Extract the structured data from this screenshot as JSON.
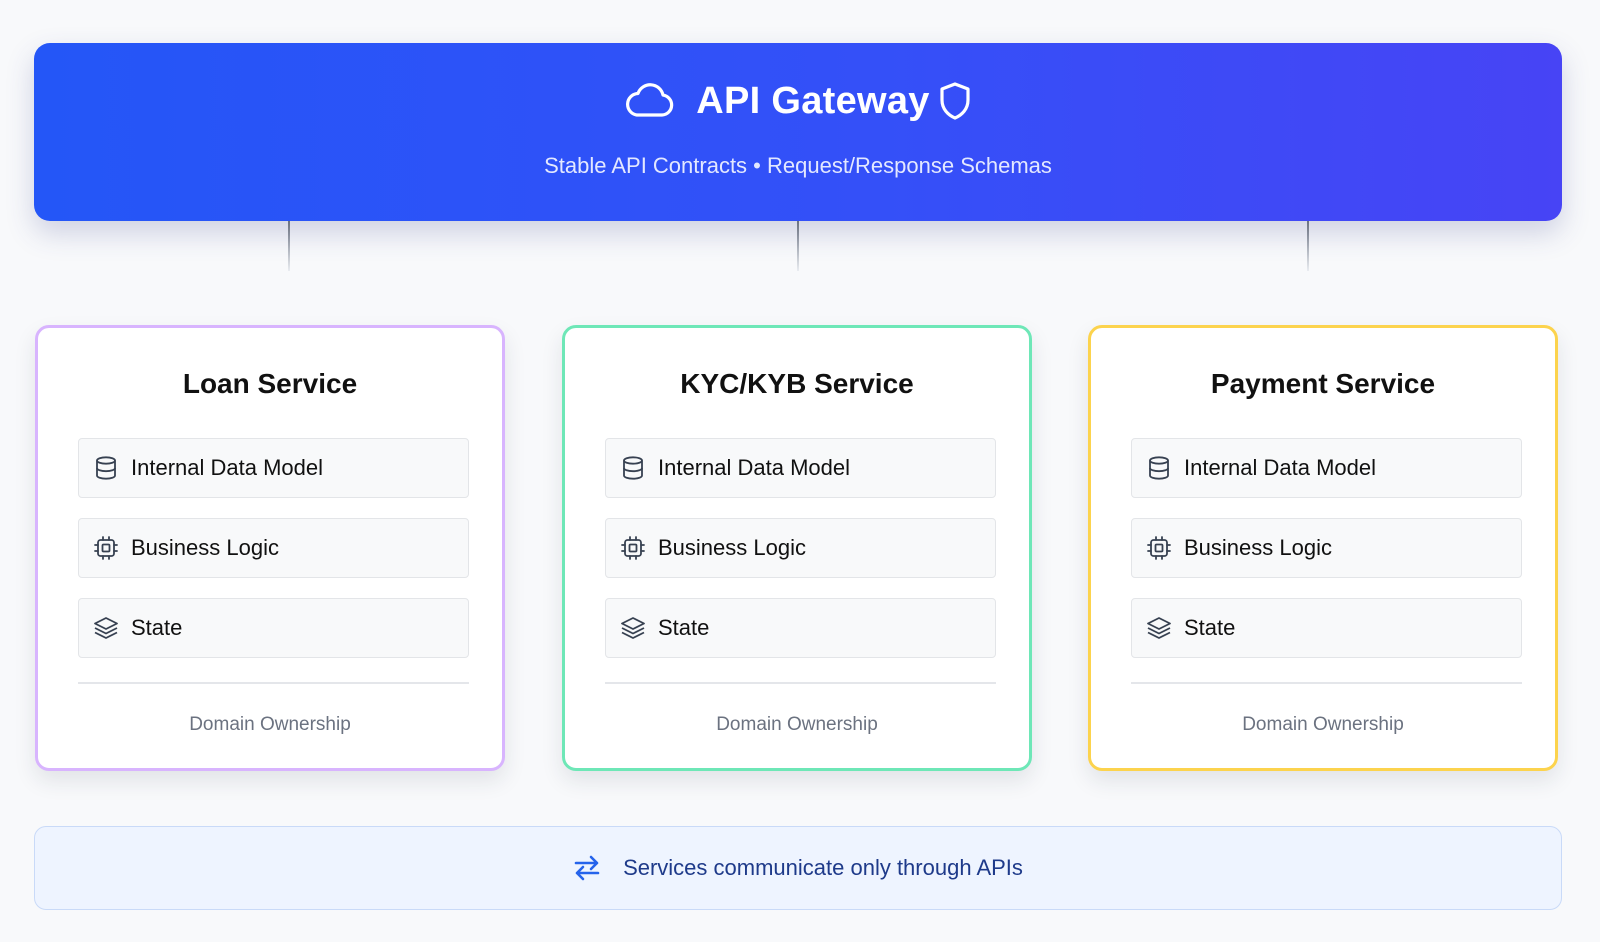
{
  "gateway": {
    "title": "API Gateway",
    "subtitle": "Stable API Contracts • Request/Response Schemas",
    "icons": [
      "cloud-icon",
      "shield-icon"
    ]
  },
  "services": [
    {
      "title": "Loan Service",
      "accent": "#d8b4fe",
      "items": [
        "Internal Data Model",
        "Business Logic",
        "State"
      ],
      "footer": "Domain Ownership"
    },
    {
      "title": "KYC/KYB Service",
      "accent": "#6ee7b7",
      "items": [
        "Internal Data Model",
        "Business Logic",
        "State"
      ],
      "footer": "Domain Ownership"
    },
    {
      "title": "Payment Service",
      "accent": "#fcd34d",
      "items": [
        "Internal Data Model",
        "Business Logic",
        "State"
      ],
      "footer": "Domain Ownership"
    }
  ],
  "item_icons": [
    "database-icon",
    "cpu-chip-icon",
    "layers-icon"
  ],
  "footer": {
    "text": "Services communicate only through APIs",
    "icon": "arrows-swap-icon"
  },
  "colors": {
    "gateway_start": "#2456f7",
    "gateway_end": "#4744f5",
    "footer_text": "#1e3a8a"
  }
}
